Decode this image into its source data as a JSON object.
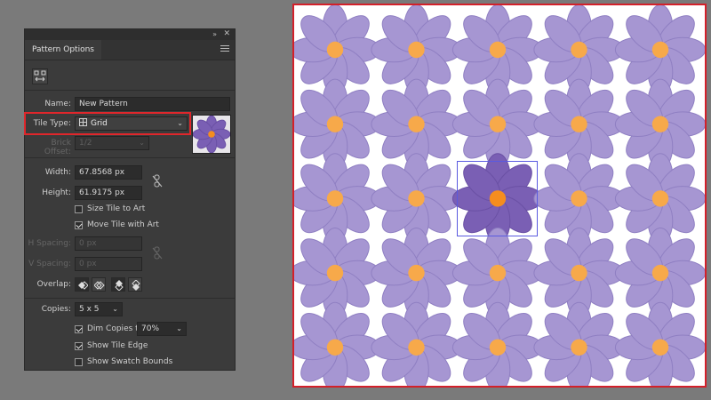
{
  "panel": {
    "title": "Pattern Options",
    "topbar": {
      "collapse_icon": "double-chevron-icon",
      "close_icon": "close-icon"
    },
    "tool_icon": "fit-tile-to-art-icon",
    "name": {
      "label": "Name:",
      "value": "New Pattern"
    },
    "tile_type": {
      "label": "Tile Type:",
      "value": "Grid",
      "icon": "grid-icon"
    },
    "brick_offset": {
      "label": "Brick Offset:",
      "value": "1/2"
    },
    "width": {
      "label": "Width:",
      "value": "67.8568 px"
    },
    "height": {
      "label": "Height:",
      "value": "61.9175 px"
    },
    "size_tile_to_art": {
      "label": "Size Tile to Art",
      "checked": false
    },
    "move_tile_with_art": {
      "label": "Move Tile with Art",
      "checked": true
    },
    "h_spacing": {
      "label": "H Spacing:",
      "value": "0 px"
    },
    "v_spacing": {
      "label": "V Spacing:",
      "value": "0 px"
    },
    "overlap": {
      "label": "Overlap:"
    },
    "copies": {
      "label": "Copies:",
      "value": "5 x 5"
    },
    "dim_copies": {
      "label": "Dim Copies to:",
      "value": "70%",
      "checked": true
    },
    "show_tile_edge": {
      "label": "Show Tile Edge",
      "checked": true
    },
    "show_swatch_bounds": {
      "label": "Show Swatch Bounds",
      "checked": false
    }
  },
  "canvas": {
    "rows": 5,
    "cols": 5,
    "center": [
      2,
      2
    ],
    "petal_color": "#a696d2",
    "petal_stroke": "#8f7fc2",
    "center_petal_color": "#7a5fb4",
    "center_petal_stroke": "#6a50a4",
    "bud_color": "#f7a94a",
    "center_bud_color": "#f58d1f"
  }
}
